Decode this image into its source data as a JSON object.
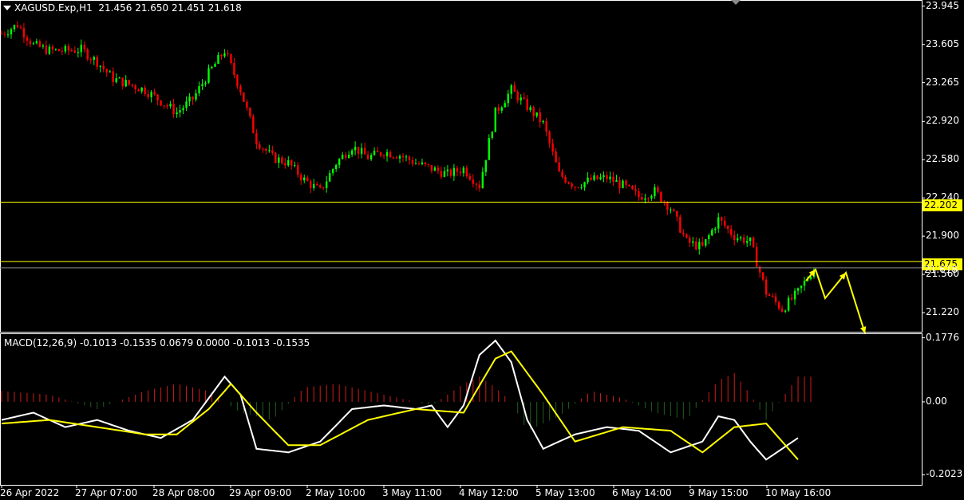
{
  "header": {
    "symbol": "XAGUSD.Exp,H1",
    "ohlc": "21.456 21.650 21.451 21.618"
  },
  "macd_header": "MACD(12,26,9) -0.1013 -0.1535 0.0679 0.0000 -0.1013 -0.1535",
  "levels": [
    {
      "label": "22.202",
      "value": 22.202
    },
    {
      "label": "21.675",
      "value": 21.675
    }
  ],
  "current_price": {
    "label": "21.618",
    "value": 21.618
  },
  "colors": {
    "bull": "#00ff00",
    "bear": "#ff0000",
    "level": "#ffff00",
    "signal": "#ffff00",
    "macd": "#ffffff",
    "hist_pos": "#d11a1a",
    "hist_neg": "#1f5f1f"
  },
  "chart_data": [
    {
      "type": "candlestick",
      "title": "XAGUSD.Exp,H1",
      "ylim": [
        21.05,
        24.0
      ],
      "yticks": [
        "23.945",
        "23.605",
        "23.265",
        "22.920",
        "22.580",
        "22.240",
        "21.900",
        "21.560",
        "21.220"
      ],
      "ytick_values": [
        23.945,
        23.605,
        23.265,
        22.92,
        22.58,
        22.24,
        21.9,
        21.56,
        21.22
      ],
      "xticks": [
        "26 Apr 2022",
        "27 Apr 07:00",
        "28 Apr 08:00",
        "29 Apr 09:00",
        "2 May 10:00",
        "3 May 11:00",
        "4 May 12:00",
        "5 May 13:00",
        "6 May 14:00",
        "9 May 15:00",
        "10 May 16:00"
      ],
      "close_path": [
        [
          0,
          23.7
        ],
        [
          5,
          23.78
        ],
        [
          10,
          23.6
        ],
        [
          15,
          23.55
        ],
        [
          20,
          23.55
        ],
        [
          25,
          23.56
        ],
        [
          30,
          23.45
        ],
        [
          35,
          23.3
        ],
        [
          40,
          23.25
        ],
        [
          45,
          23.2
        ],
        [
          50,
          23.1
        ],
        [
          55,
          23.0
        ],
        [
          60,
          23.12
        ],
        [
          65,
          23.35
        ],
        [
          70,
          23.55
        ],
        [
          75,
          23.2
        ],
        [
          80,
          22.75
        ],
        [
          85,
          22.6
        ],
        [
          90,
          22.55
        ],
        [
          95,
          22.4
        ],
        [
          100,
          22.3
        ],
        [
          105,
          22.55
        ],
        [
          110,
          22.7
        ],
        [
          115,
          22.6
        ],
        [
          120,
          22.65
        ],
        [
          125,
          22.62
        ],
        [
          130,
          22.55
        ],
        [
          135,
          22.5
        ],
        [
          140,
          22.45
        ],
        [
          145,
          22.5
        ],
        [
          150,
          22.35
        ],
        [
          155,
          23.0
        ],
        [
          160,
          23.2
        ],
        [
          165,
          23.05
        ],
        [
          170,
          22.9
        ],
        [
          175,
          22.45
        ],
        [
          180,
          22.35
        ],
        [
          185,
          22.4
        ],
        [
          190,
          22.42
        ],
        [
          195,
          22.35
        ],
        [
          200,
          22.25
        ],
        [
          205,
          22.3
        ],
        [
          210,
          22.15
        ],
        [
          215,
          21.85
        ],
        [
          220,
          21.8
        ],
        [
          225,
          22.05
        ],
        [
          230,
          21.9
        ],
        [
          235,
          21.85
        ],
        [
          240,
          21.4
        ],
        [
          245,
          21.25
        ],
        [
          250,
          21.4
        ],
        [
          255,
          21.618
        ]
      ],
      "macd": {
        "title": "MACD(12,26,9)",
        "ylim": [
          -0.23,
          0.19
        ],
        "yticks": [
          "0.1776",
          "0.00",
          "-0.2023"
        ],
        "ytick_values": [
          0.1776,
          0.0,
          -0.2023
        ],
        "main_path": [
          [
            0,
            -0.05
          ],
          [
            10,
            -0.03
          ],
          [
            20,
            -0.07
          ],
          [
            30,
            -0.05
          ],
          [
            40,
            -0.08
          ],
          [
            50,
            -0.1
          ],
          [
            60,
            -0.05
          ],
          [
            70,
            0.07
          ],
          [
            75,
            0.02
          ],
          [
            80,
            -0.13
          ],
          [
            90,
            -0.14
          ],
          [
            100,
            -0.11
          ],
          [
            110,
            -0.02
          ],
          [
            120,
            -0.01
          ],
          [
            130,
            -0.02
          ],
          [
            135,
            -0.01
          ],
          [
            140,
            -0.07
          ],
          [
            145,
            -0.01
          ],
          [
            150,
            0.13
          ],
          [
            155,
            0.17
          ],
          [
            160,
            0.11
          ],
          [
            165,
            -0.05
          ],
          [
            170,
            -0.13
          ],
          [
            180,
            -0.09
          ],
          [
            190,
            -0.07
          ],
          [
            200,
            -0.08
          ],
          [
            210,
            -0.14
          ],
          [
            220,
            -0.11
          ],
          [
            225,
            -0.04
          ],
          [
            230,
            -0.05
          ],
          [
            235,
            -0.11
          ],
          [
            240,
            -0.16
          ],
          [
            250,
            -0.1
          ]
        ],
        "signal_path": [
          [
            0,
            -0.06
          ],
          [
            15,
            -0.05
          ],
          [
            30,
            -0.07
          ],
          [
            45,
            -0.09
          ],
          [
            55,
            -0.09
          ],
          [
            65,
            -0.02
          ],
          [
            72,
            0.05
          ],
          [
            80,
            -0.03
          ],
          [
            90,
            -0.12
          ],
          [
            100,
            -0.12
          ],
          [
            115,
            -0.05
          ],
          [
            130,
            -0.02
          ],
          [
            145,
            -0.03
          ],
          [
            155,
            0.12
          ],
          [
            160,
            0.14
          ],
          [
            170,
            0.02
          ],
          [
            180,
            -0.11
          ],
          [
            195,
            -0.07
          ],
          [
            210,
            -0.08
          ],
          [
            220,
            -0.14
          ],
          [
            230,
            -0.07
          ],
          [
            240,
            -0.06
          ],
          [
            250,
            -0.16
          ]
        ],
        "histogram_path": [
          [
            0,
            0.03
          ],
          [
            15,
            0.02
          ],
          [
            30,
            -0.02
          ],
          [
            45,
            0.03
          ],
          [
            55,
            0.05
          ],
          [
            65,
            0.03
          ],
          [
            75,
            -0.03
          ],
          [
            85,
            -0.05
          ],
          [
            95,
            0.04
          ],
          [
            105,
            0.05
          ],
          [
            115,
            0.03
          ],
          [
            125,
            0.01
          ],
          [
            135,
            -0.01
          ],
          [
            145,
            0.05
          ],
          [
            150,
            0.07
          ],
          [
            155,
            0.04
          ],
          [
            160,
            0.0
          ],
          [
            165,
            -0.08
          ],
          [
            175,
            -0.04
          ],
          [
            185,
            0.03
          ],
          [
            195,
            0.01
          ],
          [
            205,
            -0.03
          ],
          [
            215,
            -0.05
          ],
          [
            225,
            0.06
          ],
          [
            230,
            0.08
          ],
          [
            235,
            0.02
          ],
          [
            240,
            -0.05
          ],
          [
            250,
            0.07
          ]
        ]
      }
    }
  ]
}
